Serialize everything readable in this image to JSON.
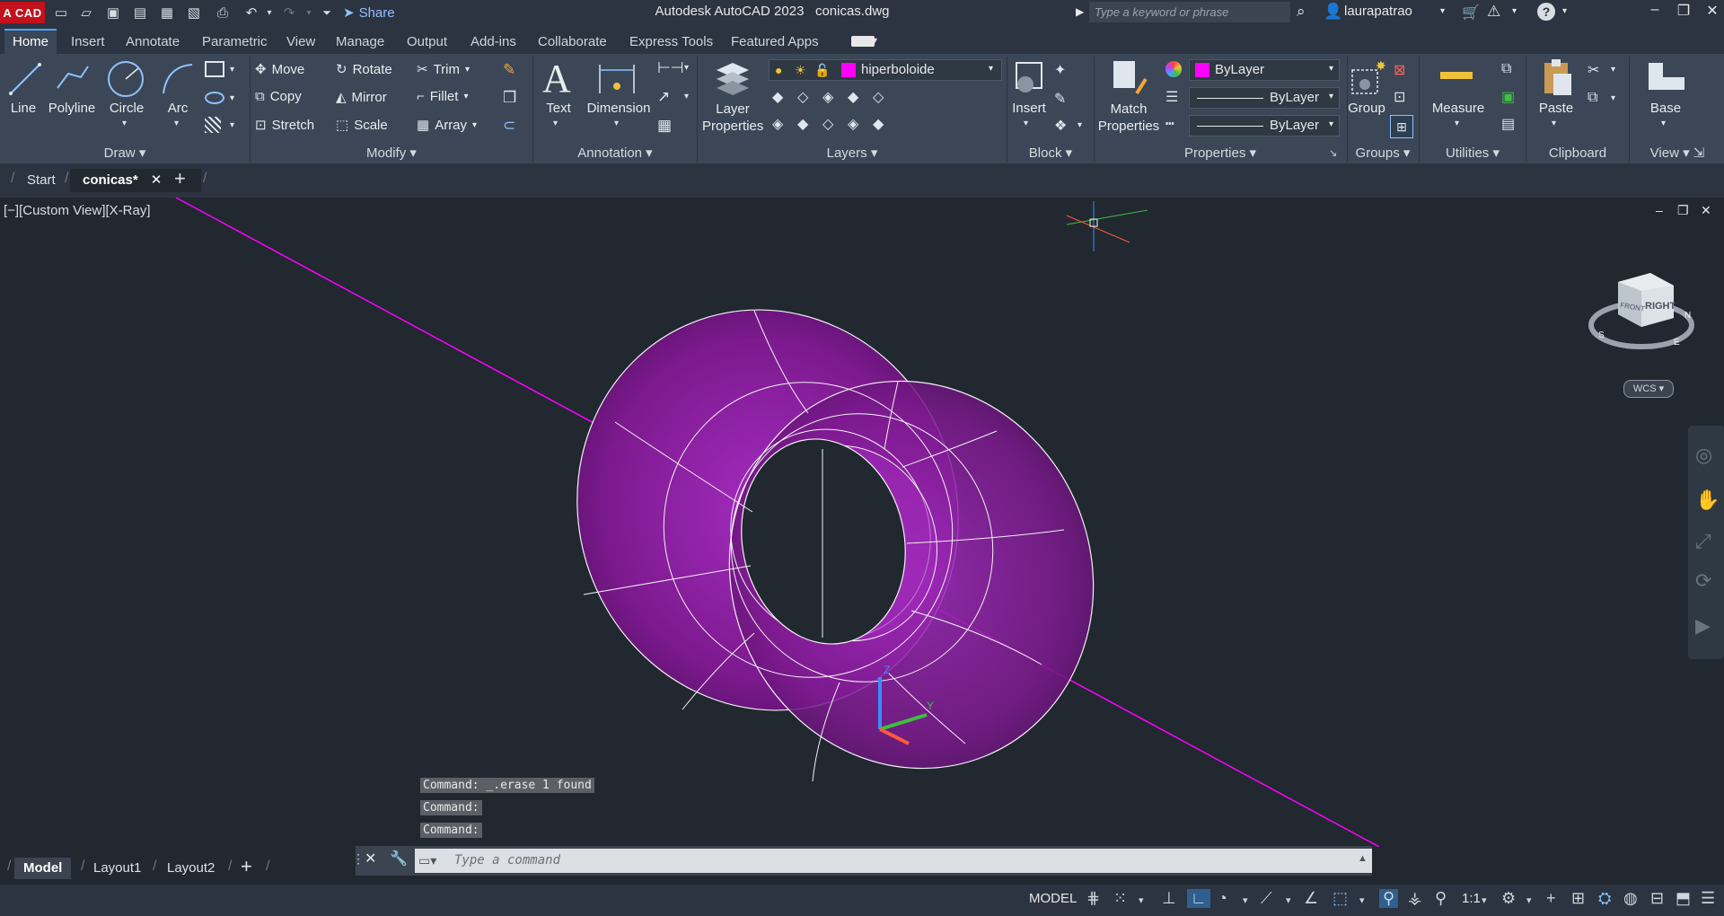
{
  "app": {
    "badge": "A CAD",
    "title": "Autodesk AutoCAD 2023",
    "file": "conicas.dwg"
  },
  "quick_access": {
    "share_label": "Share"
  },
  "search": {
    "placeholder": "Type a keyword or phrase"
  },
  "user": {
    "name": "laurapatrao"
  },
  "ribbon_tabs": [
    "Home",
    "Insert",
    "Annotate",
    "Parametric",
    "View",
    "Manage",
    "Output",
    "Add-ins",
    "Collaborate",
    "Express Tools",
    "Featured Apps"
  ],
  "draw": {
    "title": "Draw",
    "line": "Line",
    "polyline": "Polyline",
    "circle": "Circle",
    "arc": "Arc"
  },
  "modify": {
    "title": "Modify",
    "move": "Move",
    "rotate": "Rotate",
    "trim": "Trim",
    "copy": "Copy",
    "mirror": "Mirror",
    "fillet": "Fillet",
    "stretch": "Stretch",
    "scale": "Scale",
    "array": "Array"
  },
  "annotation": {
    "title": "Annotation",
    "text": "Text",
    "dimension": "Dimension"
  },
  "layers": {
    "title": "Layers",
    "layer_properties": "Layer Properties",
    "current_layer": "hiperboloide"
  },
  "block": {
    "title": "Block",
    "insert": "Insert"
  },
  "properties": {
    "title": "Properties",
    "match": "Match Properties",
    "color": "ByLayer",
    "linetype": "ByLayer",
    "lineweight": "ByLayer"
  },
  "groups": {
    "title": "Groups",
    "group": "Group"
  },
  "utilities": {
    "title": "Utilities",
    "measure": "Measure"
  },
  "clipboard": {
    "title": "Clipboard",
    "paste": "Paste"
  },
  "view": {
    "title": "View",
    "base": "Base"
  },
  "doc_tabs": {
    "start": "Start",
    "active": "conicas*"
  },
  "viewport": {
    "label": "[−][Custom View][X-Ray]",
    "viewcube_face": "RIGHT",
    "viewcube_side": "FRONT",
    "wcs": "WCS",
    "accent": "#ff00ff"
  },
  "command_history": [
    "Command: _.erase 1 found",
    "Command:",
    "Command:"
  ],
  "command_input": {
    "placeholder": "Type a command"
  },
  "layout_tabs": [
    "Model",
    "Layout1",
    "Layout2"
  ],
  "status": {
    "model": "MODEL",
    "scale": "1:1"
  }
}
